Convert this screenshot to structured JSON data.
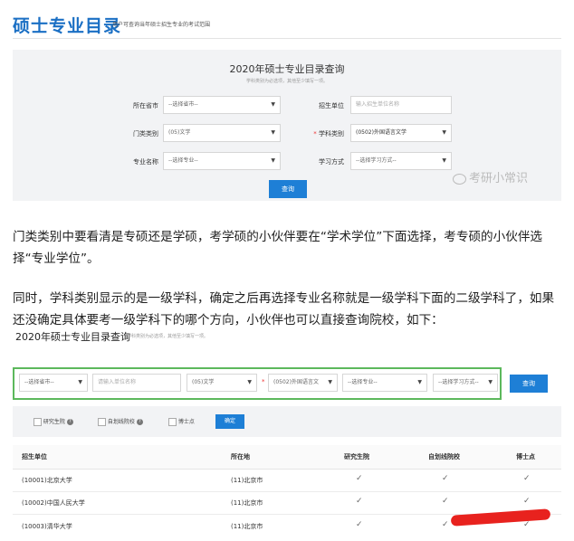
{
  "header": {
    "title": "硕士专业目录",
    "subtitle": "用户可查询当年硕士招生专业的考试范围"
  },
  "search_panel": {
    "title": "2020年硕士专业目录查询",
    "hint": "学科类别为必选项，其他至少填写一项。",
    "fields": {
      "province_label": "所在省市",
      "province_value": "--选择省市--",
      "unit_label": "招生单位",
      "unit_placeholder": "输入招生单位名称",
      "category_label": "门类类别",
      "category_value": "(05)文学",
      "subject_label": "学科类别",
      "subject_required": "*",
      "subject_value": "(0502)外国语言文学",
      "major_label": "专业名称",
      "major_value": "--选择专业--",
      "mode_label": "学习方式",
      "mode_value": "--选择学习方式--"
    },
    "search_button": "查询",
    "arrow": "▼"
  },
  "watermark": "考研小常识",
  "paragraphs": [
    "门类类别中要看清是专硕还是学硕，考学硕的小伙伴要在“学术学位”下面选择，考专硕的小伙伴选择“专业学位”。",
    "同时，学科类别显示的是一级学科，确定之后再选择专业名称就是一级学科下面的二级学科了，如果还没确定具体要考一级学科下的哪个方向，小伙伴也可以直接查询院校，如下："
  ],
  "second_panel": {
    "title": "2020年硕士专业目录查询",
    "hint": "学科类别为必选项，其他至少填写一项。",
    "province": "--选择省市--",
    "unit_placeholder": "请输入单位名称",
    "category": "(05)文学",
    "subject_required": "*",
    "subject": "(0502)外国语言文",
    "major": "--选择专业--",
    "mode": "--选择学习方式--",
    "search_button": "查询",
    "filters": {
      "grad_school": "研究生院",
      "self_line": "自划线院校",
      "doctoral": "博士点",
      "help": "?",
      "confirm_button": "确定"
    },
    "table": {
      "headers": [
        "招生单位",
        "所在地",
        "研究生院",
        "自划线院校",
        "博士点"
      ],
      "rows": [
        {
          "unit": "(10001)北京大学",
          "location": "(11)北京市",
          "grad": "✓",
          "self": "✓",
          "phd": "✓"
        },
        {
          "unit": "(10002)中国人民大学",
          "location": "(11)北京市",
          "grad": "✓",
          "self": "✓",
          "phd": "✓"
        },
        {
          "unit": "(10003)清华大学",
          "location": "(11)北京市",
          "grad": "✓",
          "self": "✓",
          "phd": "✓"
        }
      ]
    }
  }
}
